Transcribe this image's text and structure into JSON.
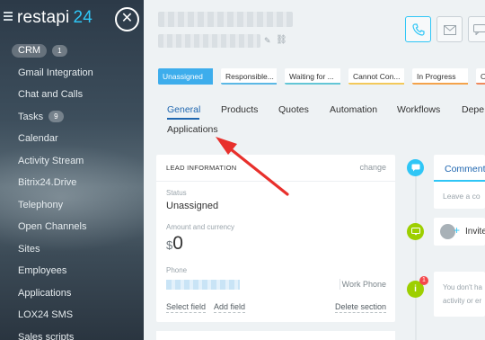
{
  "brand": {
    "name": "restapi",
    "version": "24"
  },
  "colors": {
    "accent": "#2fc6f6",
    "link": "#2067b0",
    "stage_active": "#3dadec",
    "arrow": "#e8302c"
  },
  "sidebar": {
    "crm_label": "CRM",
    "crm_count": "1",
    "items": [
      {
        "label": "Gmail Integration"
      },
      {
        "label": "Chat and Calls"
      },
      {
        "label": "Tasks",
        "count": "9"
      },
      {
        "label": "Calendar"
      },
      {
        "label": "Activity Stream"
      },
      {
        "label": "Bitrix24.Drive"
      },
      {
        "label": "Telephony"
      },
      {
        "label": "Open Channels"
      },
      {
        "label": "Sites"
      },
      {
        "label": "Employees"
      },
      {
        "label": "Applications"
      },
      {
        "label": "LOX24 SMS"
      },
      {
        "label": "Sales scripts"
      }
    ]
  },
  "header": {
    "actions": [
      {
        "icon": "phone-icon"
      },
      {
        "icon": "mail-icon"
      },
      {
        "icon": "chat-icon"
      }
    ]
  },
  "stages": [
    {
      "label": "Unassigned",
      "color": "#3dadec",
      "active": true
    },
    {
      "label": "Responsible...",
      "color": "#5bb8e5"
    },
    {
      "label": "Waiting for ...",
      "color": "#63c6d6"
    },
    {
      "label": "Cannot Con...",
      "color": "#f3c95a"
    },
    {
      "label": "In Progress",
      "color": "#f4a34b"
    },
    {
      "label": "O",
      "color": "#ef8a5e"
    }
  ],
  "tabs": [
    {
      "label": "General",
      "active": true
    },
    {
      "label": "Products"
    },
    {
      "label": "Quotes"
    },
    {
      "label": "Automation"
    },
    {
      "label": "Workflows"
    },
    {
      "label": "Depe"
    },
    {
      "label": "Applications"
    }
  ],
  "lead_info": {
    "heading": "LEAD INFORMATION",
    "change": "change",
    "status_label": "Status",
    "status_value": "Unassigned",
    "amount_label": "Amount and currency",
    "currency": "$",
    "amount": "0",
    "phone_label": "Phone",
    "phone_type": "Work Phone",
    "select_field": "Select field",
    "add_field": "Add field",
    "delete_section": "Delete section"
  },
  "timeline": {
    "comment_tab": "Comment",
    "comment_placeholder": "Leave a co",
    "invite": "Invite",
    "warning_badge": "1",
    "warning_line1": "You don't ha",
    "warning_line2": "activity or er"
  }
}
